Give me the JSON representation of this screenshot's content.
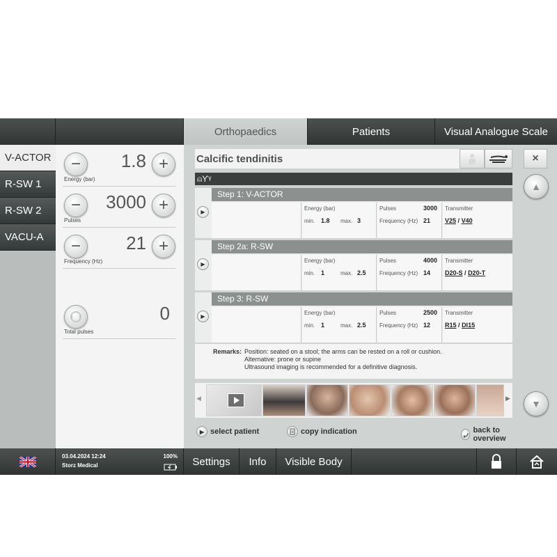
{
  "topbar": {
    "tabs": [
      {
        "label": "Orthopaedics"
      },
      {
        "label": "Patients"
      },
      {
        "label": "Visual Analogue Scale"
      }
    ]
  },
  "leftmenu": {
    "items": [
      {
        "label": "V-ACTOR"
      },
      {
        "label": "R-SW 1"
      },
      {
        "label": "R-SW 2"
      },
      {
        "label": "VACU-A"
      }
    ]
  },
  "params": {
    "energy": {
      "value": "1.8",
      "label": "Energy (bar)"
    },
    "pulses": {
      "value": "3000",
      "label": "Pulses"
    },
    "frequency": {
      "value": "21",
      "label": "Frequency (Hz)"
    },
    "total": {
      "value": "0",
      "label": "Total pulses"
    },
    "minus": "−",
    "plus": "+"
  },
  "main": {
    "title": "Calcific tendinitis",
    "close": "×",
    "tools": "⍝Ƴᵞ",
    "labels": {
      "energy": "Energy (bar)",
      "min": "min.",
      "max": "max.",
      "pulses": "Pulses",
      "frequency": "Frequency (Hz)",
      "transmitter": "Transmitter",
      "sep": "/"
    },
    "steps": [
      {
        "title": "Step 1:   V-ACTOR",
        "min": "1.8",
        "max": "3",
        "pulses": "3000",
        "freq": "21",
        "t1": "V25",
        "t2": "V40"
      },
      {
        "title": "Step 2a:   R-SW",
        "min": "1",
        "max": "2.5",
        "pulses": "4000",
        "freq": "14",
        "t1": "D20-S",
        "t2": "D20-T"
      },
      {
        "title": "Step 3:   R-SW",
        "min": "1",
        "max": "2.5",
        "pulses": "2500",
        "freq": "12",
        "t1": "R15",
        "t2": "DI15"
      }
    ],
    "remarks": {
      "label": "Remarks:",
      "line1": "Position: seated on a stool; the arms can be rested on a roll or cushion.",
      "line2": "Alternative: prone or supine",
      "line3": "Ultrasound imaging is recommended for a definitive diagnosis."
    },
    "links": {
      "select_patient": "select patient",
      "copy_indication": "copy indication",
      "back": "back to overview"
    }
  },
  "footer": {
    "date": "03.04.2024 12:24",
    "company": "Storz Medical",
    "battery": "100%",
    "settings": "Settings",
    "info": "Info",
    "visible_body": "Visible Body"
  },
  "colors": {
    "dark_bar": "#3a3e3d",
    "panel": "#cfd3d2",
    "step_header": "#8c9190"
  }
}
